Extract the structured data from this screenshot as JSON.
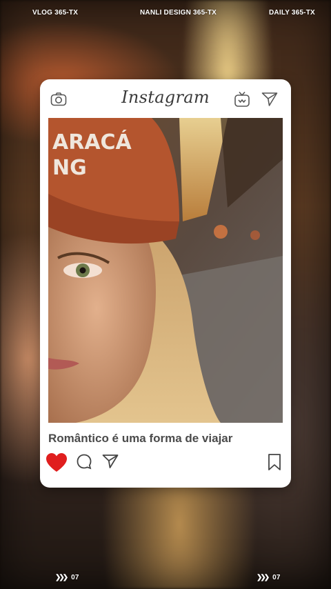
{
  "top_labels": {
    "left": "VLOG 365-TX",
    "center": "NANLI DESIGN 365-TX",
    "right": "DAILY 365-TX"
  },
  "bottom_labels": {
    "left": "07",
    "right": "07"
  },
  "post": {
    "app_name": "Instagram",
    "caption": "Romântico é uma forma de viajar",
    "liked": true,
    "photo": {
      "cap_text": "ARACÁ NG"
    }
  },
  "icons": {
    "camera": "camera-icon",
    "igtv": "igtv-icon",
    "direct": "send-icon",
    "like": "heart-icon",
    "comment": "comment-icon",
    "share": "share-icon",
    "save": "bookmark-icon",
    "arrows": "double-chevron-icon"
  },
  "colors": {
    "card": "#ffffff",
    "heart": "#e01e1e",
    "text": "#4a4a4a",
    "logo": "#3a3a3a"
  }
}
